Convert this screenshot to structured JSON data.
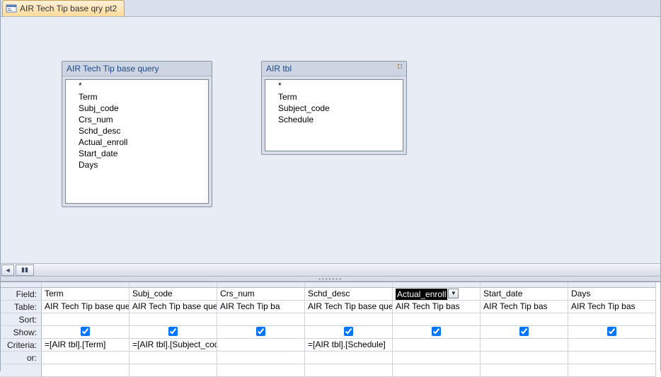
{
  "tab": {
    "label": "AIR Tech Tip base qry pt2"
  },
  "boxes": [
    {
      "title": "AIR Tech Tip base query",
      "fields": [
        "*",
        "Term",
        "Subj_code",
        "Crs_num",
        "Schd_desc",
        "Actual_enroll",
        "Start_date",
        "Days"
      ]
    },
    {
      "title": "AIR tbl",
      "fields": [
        "*",
        "Term",
        "Subject_code",
        "Schedule"
      ]
    }
  ],
  "grid": {
    "rowLabels": [
      "Field:",
      "Table:",
      "Sort:",
      "Show:",
      "Criteria:",
      "or:"
    ],
    "columns": [
      {
        "field": "Term",
        "table": "AIR Tech Tip base que",
        "sort": "",
        "show": true,
        "criteria": "=[AIR tbl].[Term]",
        "or": "",
        "selected": false
      },
      {
        "field": "Subj_code",
        "table": "AIR Tech Tip base query",
        "sort": "",
        "show": true,
        "criteria": "=[AIR tbl].[Subject_code]",
        "or": "",
        "selected": false
      },
      {
        "field": "Crs_num",
        "table": "AIR Tech Tip ba",
        "sort": "",
        "show": true,
        "criteria": "",
        "or": "",
        "selected": false
      },
      {
        "field": "Schd_desc",
        "table": "AIR Tech Tip base quer",
        "sort": "",
        "show": true,
        "criteria": "=[AIR tbl].[Schedule]",
        "or": "",
        "selected": false
      },
      {
        "field": "Actual_enroll",
        "table": "AIR Tech Tip bas",
        "sort": "",
        "show": true,
        "criteria": "",
        "or": "",
        "selected": true
      },
      {
        "field": "Start_date",
        "table": "AIR Tech Tip bas",
        "sort": "",
        "show": true,
        "criteria": "",
        "or": "",
        "selected": false
      },
      {
        "field": "Days",
        "table": "AIR Tech Tip bas",
        "sort": "",
        "show": true,
        "criteria": "",
        "or": "",
        "selected": false
      }
    ]
  }
}
